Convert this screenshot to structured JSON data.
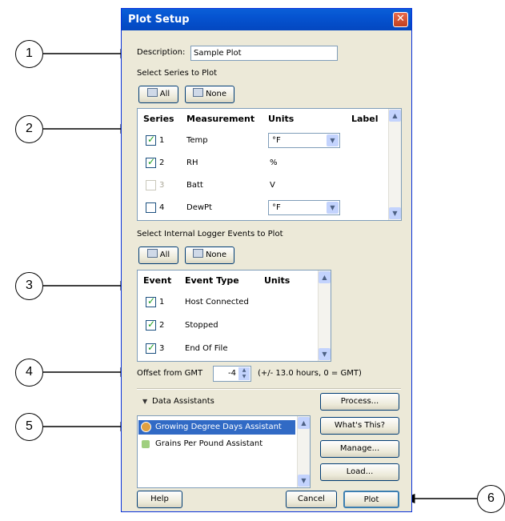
{
  "dialog": {
    "title": "Plot Setup",
    "close_glyph": "✕"
  },
  "description": {
    "label": "Description:",
    "value": "Sample Plot"
  },
  "series_section": {
    "title": "Select Series to Plot",
    "all_label": "All",
    "none_label": "None",
    "headers": {
      "series": "Series",
      "measurement": "Measurement",
      "units": "Units",
      "label": "Label"
    },
    "rows": [
      {
        "num": "1",
        "measurement": "Temp",
        "units": "°F",
        "checked": true
      },
      {
        "num": "2",
        "measurement": "RH",
        "units": "%",
        "checked": true
      },
      {
        "num": "3",
        "measurement": "Batt",
        "units": "V",
        "checked": false
      },
      {
        "num": "4",
        "measurement": "DewPt",
        "units": "°F",
        "checked": false
      }
    ]
  },
  "events_section": {
    "title": "Select Internal Logger Events to Plot",
    "all_label": "All",
    "none_label": "None",
    "headers": {
      "event": "Event",
      "event_type": "Event Type",
      "units": "Units"
    },
    "rows": [
      {
        "num": "1",
        "type": "Host Connected"
      },
      {
        "num": "2",
        "type": "Stopped"
      },
      {
        "num": "3",
        "type": "End Of File"
      }
    ]
  },
  "offset": {
    "label": "Offset from GMT",
    "value": "-4",
    "hint": "(+/- 13.0 hours, 0 = GMT)"
  },
  "assistants": {
    "title": "Data Assistants",
    "items": [
      "Growing Degree Days Assistant",
      "Grains Per Pound Assistant"
    ],
    "process_label": "Process...",
    "whats_this_label": "What's This?",
    "manage_label": "Manage...",
    "load_label": "Load..."
  },
  "footer": {
    "help_label": "Help",
    "cancel_label": "Cancel",
    "plot_label": "Plot"
  },
  "callouts": [
    "1",
    "2",
    "3",
    "4",
    "5",
    "6"
  ]
}
